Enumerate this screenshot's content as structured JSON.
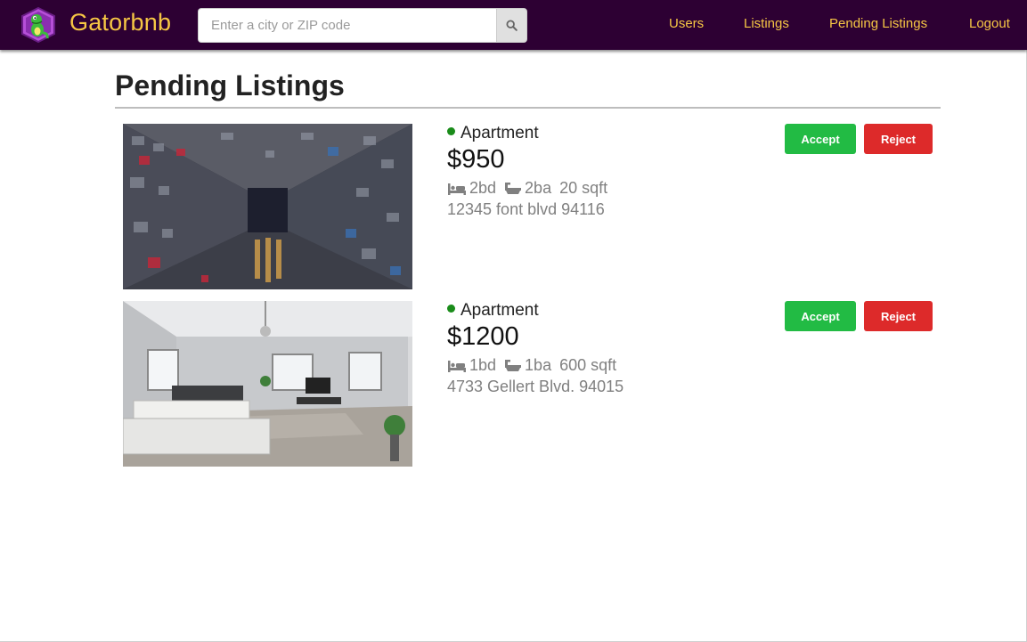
{
  "navbar": {
    "brand": "Gatorbnb",
    "search": {
      "placeholder": "Enter a city or ZIP code",
      "value": ""
    },
    "links": [
      "Users",
      "Listings",
      "Pending Listings",
      "Logout"
    ]
  },
  "main": {
    "title": "Pending Listings",
    "listings": [
      {
        "type": "Apartment",
        "price": "$950",
        "beds": "2bd",
        "baths": "2ba",
        "sqft": "20 sqft",
        "address": "12345 font blvd 94116",
        "accept_label": "Accept",
        "reject_label": "Reject"
      },
      {
        "type": "Apartment",
        "price": "$1200",
        "beds": "1bd",
        "baths": "1ba",
        "sqft": "600 sqft",
        "address": "4733 Gellert Blvd. 94015",
        "accept_label": "Accept",
        "reject_label": "Reject"
      }
    ]
  },
  "colors": {
    "navbar_bg": "#2d0033",
    "brand_gold": "#f6c644",
    "accept_green": "#22bb44",
    "reject_red": "#dd2a2a",
    "status_green": "#1a8c1a"
  },
  "icons": [
    "gator-logo",
    "search-icon",
    "bed-icon",
    "bath-icon"
  ]
}
